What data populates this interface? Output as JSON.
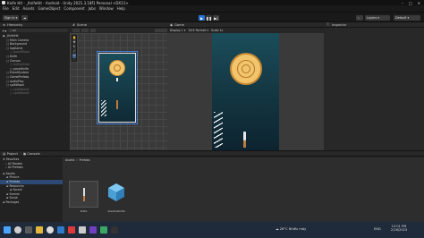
{
  "window": {
    "title": "Knife Hit - _KnifeHit - Android - Unity 2021.3.18f1 Personal <DX11>"
  },
  "menu": [
    "File",
    "Edit",
    "Assets",
    "GameObject",
    "Component",
    "Jobs",
    "Window",
    "Help"
  ],
  "toolbar": {
    "account": "Sign in",
    "layers": "Layers",
    "layout": "Default"
  },
  "hierarchy": {
    "tab": "Hierarchy",
    "search_placeholder": "All",
    "items": [
      {
        "label": "_KnifeHit",
        "indent": 0,
        "active": true
      },
      {
        "label": "Main Camera",
        "indent": 1,
        "active": true
      },
      {
        "label": "Background",
        "indent": 1,
        "active": true
      },
      {
        "label": "logGame",
        "indent": 1,
        "active": true
      },
      {
        "label": "panelWood",
        "indent": 2,
        "active": false
      },
      {
        "label": "Knife",
        "indent": 1,
        "active": true
      },
      {
        "label": "Canvas",
        "indent": 1,
        "active": true
      },
      {
        "label": "buttonStart",
        "indent": 2,
        "active": false
      },
      {
        "label": "panelKnife",
        "indent": 2,
        "active": true
      },
      {
        "label": "EventSystem",
        "indent": 1,
        "active": true
      },
      {
        "label": "GamePrefabs",
        "indent": 1,
        "active": true
      },
      {
        "label": "audioPlay",
        "indent": 1,
        "active": true
      },
      {
        "label": "splitWood",
        "indent": 1,
        "active": true
      },
      {
        "label": "splitWood1",
        "indent": 2,
        "active": false
      },
      {
        "label": "splitWood2",
        "indent": 2,
        "active": false
      }
    ]
  },
  "scene": {
    "tab": "Scene"
  },
  "game": {
    "tab": "Game",
    "display": "Display 1",
    "aspect": "16:9 Portrait",
    "scale_label": "Scale",
    "scale_value": "1x"
  },
  "inspector": {
    "tab": "Inspector"
  },
  "bottom": {
    "tabs": [
      "Project",
      "Console"
    ],
    "favorites": [
      "All Models",
      "All Prefabs"
    ],
    "tree": [
      {
        "label": "Assets",
        "indent": 0
      },
      {
        "label": "Picture",
        "indent": 1
      },
      {
        "label": "Prefabs",
        "indent": 1,
        "selected": true
      },
      {
        "label": "Resources",
        "indent": 1
      },
      {
        "label": "Sound",
        "indent": 2
      },
      {
        "label": "Scenes",
        "indent": 1
      },
      {
        "label": "Script",
        "indent": 1
      },
      {
        "label": "Packages",
        "indent": 0
      }
    ],
    "breadcrumb": [
      "Assets",
      "Prefabs"
    ],
    "assets": [
      {
        "label": "Knife"
      },
      {
        "label": "shadowKnife"
      }
    ]
  },
  "taskbar": {
    "weather": "26°C Nhiều mây",
    "language": "ENG",
    "time": "12:01 PM",
    "date": "2/16/2023"
  },
  "colors": {
    "game_bg_top": "#1b4d5a",
    "game_bg_bottom": "#0f2a35",
    "wood": "#f2c46b",
    "play_active": "#2b74d6"
  }
}
